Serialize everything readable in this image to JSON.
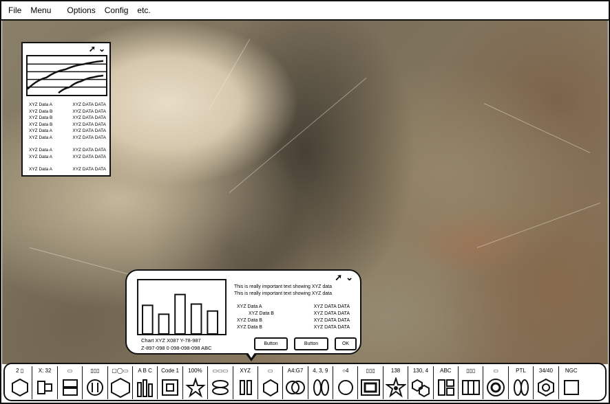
{
  "menu": {
    "items": [
      "File",
      "Menu",
      "Options",
      "Config",
      "etc."
    ]
  },
  "panel_top": {
    "expand_icon": "arrow-up-right",
    "collapse_icon": "chevron-down",
    "rows": [
      {
        "label": "XYZ Data A",
        "value": "XYZ DATA DATA"
      },
      {
        "label": "XYZ Data B",
        "value": "XYZ DATA DATA"
      },
      {
        "label": "XYZ Data B",
        "value": "XYZ DATA DATA"
      },
      {
        "label": "XYZ Data B",
        "value": "XYZ DATA DATA"
      },
      {
        "label": "XYZ Data A",
        "value": "XYZ DATA DATA"
      },
      {
        "label": "XYZ Data A",
        "value": "XYZ DATA DATA"
      },
      {
        "label": "XYZ Data A",
        "value": "XYZ DATA DATA"
      },
      {
        "label": "XYZ Data A",
        "value": "XYZ DATA DATA"
      },
      {
        "label": "XYZ Data A",
        "value": "XYZ DATA DATA"
      }
    ]
  },
  "panel_bottom": {
    "expand_icon": "arrow-up-right",
    "collapse_icon": "chevron-down",
    "chart_caption_1": "Chart XYZ      X087 Y-78-987",
    "chart_caption_2": "Z-897-098 0  098-098-098 ABC",
    "important_1": "This is really important text showing XYZ data",
    "important_2": "This is really important text showing XYZ data",
    "rows": [
      {
        "label": "XYZ Data A",
        "value": "XYZ DATA DATA"
      },
      {
        "label": "XYZ Data B",
        "value": "XYZ DATA DATA"
      },
      {
        "label": "XYZ Data B",
        "value": "XYZ DATA DATA"
      },
      {
        "label": "XYZ Data B",
        "value": "XYZ DATA DATA"
      }
    ],
    "buttons": [
      "Button",
      "Button",
      "OK"
    ]
  },
  "chart_data": [
    {
      "type": "line",
      "series": [
        {
          "values": [
            0.15,
            0.45,
            0.66,
            0.8,
            0.88
          ]
        },
        {
          "values": [
            0.05,
            0.2,
            0.35,
            0.45,
            0.5
          ]
        }
      ],
      "grid": true
    },
    {
      "type": "bar",
      "values": [
        4.5,
        3.1,
        6.2,
        4.7,
        3.6
      ],
      "ylim": [
        0,
        8
      ]
    }
  ],
  "toolbar": {
    "tools": [
      {
        "label": "2 ▯",
        "icon": "hexagon-icon"
      },
      {
        "label": "X: 32",
        "icon": "split-rect-icon"
      },
      {
        "label": "▭",
        "icon": "stacked-rect-icon"
      },
      {
        "label": "▯▯▯",
        "icon": "circle-bars-icon"
      },
      {
        "label": "▢◯▭",
        "icon": "hexagon-large-icon"
      },
      {
        "label": "A  B  C",
        "icon": "bars-icon"
      },
      {
        "label": "Code 1",
        "icon": "nested-square-icon"
      },
      {
        "label": "100%",
        "icon": "star-icon"
      },
      {
        "label": "▭▭▭",
        "icon": "ellipses-icon"
      },
      {
        "label": "XYZ",
        "icon": "double-bar-icon"
      },
      {
        "label": "▭",
        "icon": "hexagon-outline-icon"
      },
      {
        "label": "A4:G7",
        "icon": "double-circle-icon"
      },
      {
        "label": "4, 3, 9",
        "icon": "double-oval-icon"
      },
      {
        "label": "○4",
        "icon": "circle-icon"
      },
      {
        "label": "▯▯▯",
        "icon": "framed-rect-icon"
      },
      {
        "label": "138",
        "icon": "star-burst-icon"
      },
      {
        "label": "130, 4",
        "icon": "hexagon-pair-icon"
      },
      {
        "label": "ABC",
        "icon": "grid-blocks-icon"
      },
      {
        "label": "▯▯▯",
        "icon": "columns-icon"
      },
      {
        "label": "▭",
        "icon": "target-circle-icon"
      },
      {
        "label": "PTL",
        "icon": "oval-pair-icon"
      },
      {
        "label": "34/40",
        "icon": "nut-icon"
      },
      {
        "label": "NGC",
        "icon": "square-icon"
      }
    ]
  }
}
